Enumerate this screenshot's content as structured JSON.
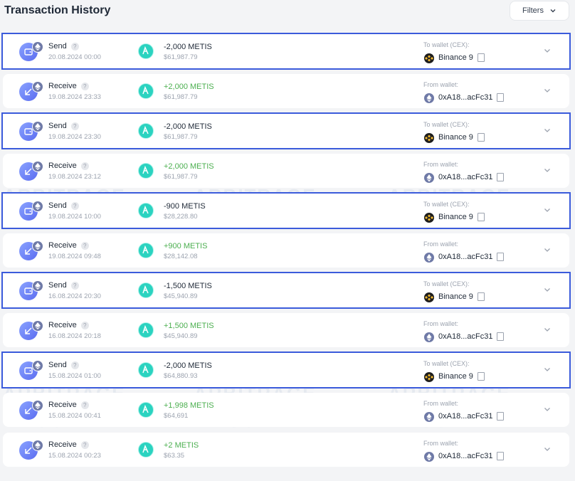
{
  "header": {
    "title": "Transaction History",
    "filters_label": "Filters"
  },
  "watermark": {
    "line1": "ARBITRAGE",
    "line2": "SCANNER"
  },
  "transactions": [
    {
      "type": "Send",
      "date": "20.08.2024 00:00",
      "amount": "-2,000 METIS",
      "usd": "$61,987.79",
      "wallet_label": "To wallet (CEX):",
      "wallet": "Binance 9",
      "wallet_kind": "bnb",
      "selected": true
    },
    {
      "type": "Receive",
      "date": "19.08.2024 23:33",
      "amount": "+2,000 METIS",
      "usd": "$61,987.79",
      "wallet_label": "From wallet:",
      "wallet": "0xA18...acFc31",
      "wallet_kind": "eth",
      "selected": false
    },
    {
      "type": "Send",
      "date": "19.08.2024 23:30",
      "amount": "-2,000 METIS",
      "usd": "$61,987.79",
      "wallet_label": "To wallet (CEX):",
      "wallet": "Binance 9",
      "wallet_kind": "bnb",
      "selected": true
    },
    {
      "type": "Receive",
      "date": "19.08.2024 23:12",
      "amount": "+2,000 METIS",
      "usd": "$61,987.79",
      "wallet_label": "From wallet:",
      "wallet": "0xA18...acFc31",
      "wallet_kind": "eth",
      "selected": false
    },
    {
      "type": "Send",
      "date": "19.08.2024 10:00",
      "amount": "-900 METIS",
      "usd": "$28,228.80",
      "wallet_label": "To wallet (CEX):",
      "wallet": "Binance 9",
      "wallet_kind": "bnb",
      "selected": true
    },
    {
      "type": "Receive",
      "date": "19.08.2024 09:48",
      "amount": "+900 METIS",
      "usd": "$28,142.08",
      "wallet_label": "From wallet:",
      "wallet": "0xA18...acFc31",
      "wallet_kind": "eth",
      "selected": false
    },
    {
      "type": "Send",
      "date": "16.08.2024 20:30",
      "amount": "-1,500 METIS",
      "usd": "$45,940.89",
      "wallet_label": "To wallet (CEX):",
      "wallet": "Binance 9",
      "wallet_kind": "bnb",
      "selected": true
    },
    {
      "type": "Receive",
      "date": "16.08.2024 20:18",
      "amount": "+1,500 METIS",
      "usd": "$45,940.89",
      "wallet_label": "From wallet:",
      "wallet": "0xA18...acFc31",
      "wallet_kind": "eth",
      "selected": false
    },
    {
      "type": "Send",
      "date": "15.08.2024 01:00",
      "amount": "-2,000 METIS",
      "usd": "$64,880.93",
      "wallet_label": "To wallet (CEX):",
      "wallet": "Binance 9",
      "wallet_kind": "bnb",
      "selected": true
    },
    {
      "type": "Receive",
      "date": "15.08.2024 00:41",
      "amount": "+1,998 METIS",
      "usd": "$64,691",
      "wallet_label": "From wallet:",
      "wallet": "0xA18...acFc31",
      "wallet_kind": "eth",
      "selected": false
    },
    {
      "type": "Receive",
      "date": "15.08.2024 00:23",
      "amount": "+2 METIS",
      "usd": "$63.35",
      "wallet_label": "From wallet:",
      "wallet": "0xA18...acFc31",
      "wallet_kind": "eth",
      "selected": false
    }
  ],
  "help_glyph": "?",
  "colors": {
    "accent_border": "#3b5bdb",
    "positive": "#4caf50",
    "metis": "#2bd3c0"
  }
}
